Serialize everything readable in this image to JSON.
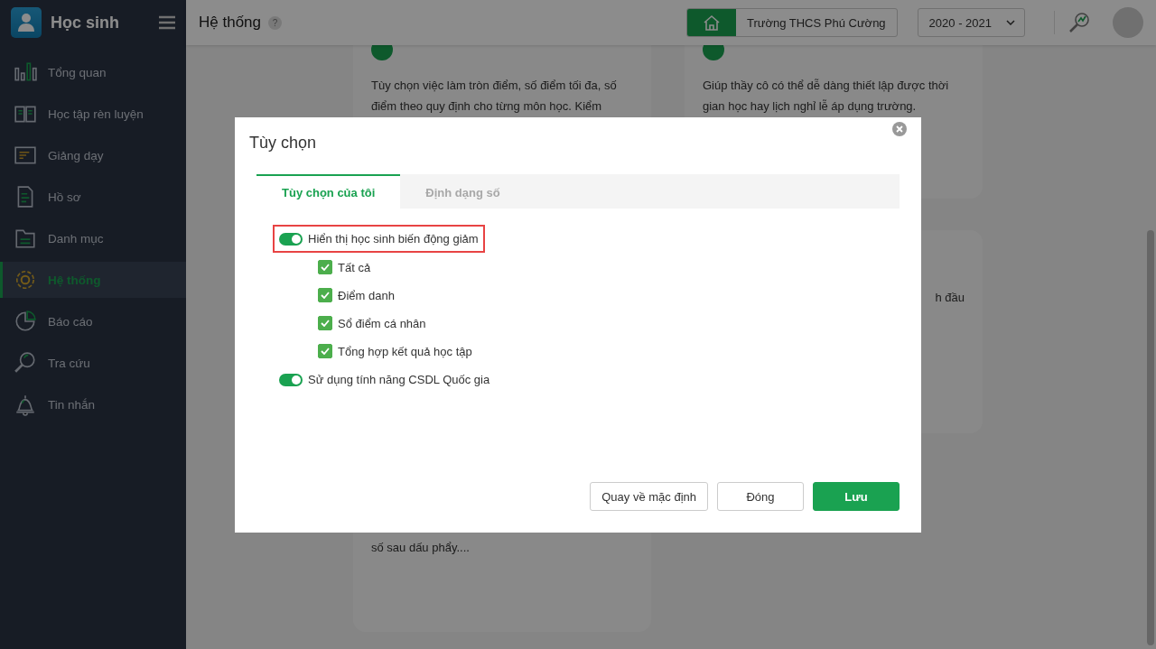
{
  "sidebar": {
    "app_title": "Học sinh",
    "items": [
      {
        "label": "Tổng quan",
        "kind": "chart",
        "selected": false
      },
      {
        "label": "Học tập rèn luyện",
        "kind": "book",
        "selected": false
      },
      {
        "label": "Giảng dạy",
        "kind": "board",
        "selected": false
      },
      {
        "label": "Hồ sơ",
        "kind": "doc",
        "selected": false
      },
      {
        "label": "Danh mục",
        "kind": "folder",
        "selected": false
      },
      {
        "label": "Hệ thống",
        "kind": "gear",
        "selected": true
      },
      {
        "label": "Báo cáo",
        "kind": "pie",
        "selected": false
      },
      {
        "label": "Tra cứu",
        "kind": "search",
        "selected": false
      },
      {
        "label": "Tin nhắn",
        "kind": "bell",
        "selected": false
      }
    ]
  },
  "header": {
    "title": "Hệ thống",
    "help": "?",
    "school": "Trường THCS Phú Cường",
    "year": "2020 - 2021"
  },
  "cards": [
    {
      "description": "Tùy chọn việc làm tròn điểm, số điểm tối đa, số điểm theo quy định cho từng môn học. Kiểm",
      "tail": "số sau dấu phẩy...."
    },
    {
      "description": "Giúp thầy cô có thể dễ dàng thiết lập được thời gian học hay lịch nghỉ lễ áp dụng trường."
    },
    {
      "fragment": "h đầu"
    }
  ],
  "dialog": {
    "title": "Tùy chọn",
    "tabs": [
      {
        "label": "Tùy chọn của tôi",
        "selected": true
      },
      {
        "label": "Định dạng số",
        "selected": false
      }
    ],
    "options": [
      {
        "label": "Hiển thị học sinh biến động giảm",
        "on": true,
        "highlighted": true,
        "children": [
          {
            "label": "Tất cả",
            "checked": true
          },
          {
            "label": "Điểm danh",
            "checked": true
          },
          {
            "label": "Sổ điểm cá nhân",
            "checked": true
          },
          {
            "label": "Tổng hợp kết quả học tập",
            "checked": true
          }
        ]
      },
      {
        "label": "Sử dụng tính năng CSDL Quốc gia",
        "on": true,
        "highlighted": false
      }
    ],
    "buttons": [
      {
        "label": "Quay về mặc định",
        "kind": "secondary"
      },
      {
        "label": "Đóng",
        "kind": "secondary"
      },
      {
        "label": "Lưu",
        "kind": "primary"
      }
    ]
  }
}
